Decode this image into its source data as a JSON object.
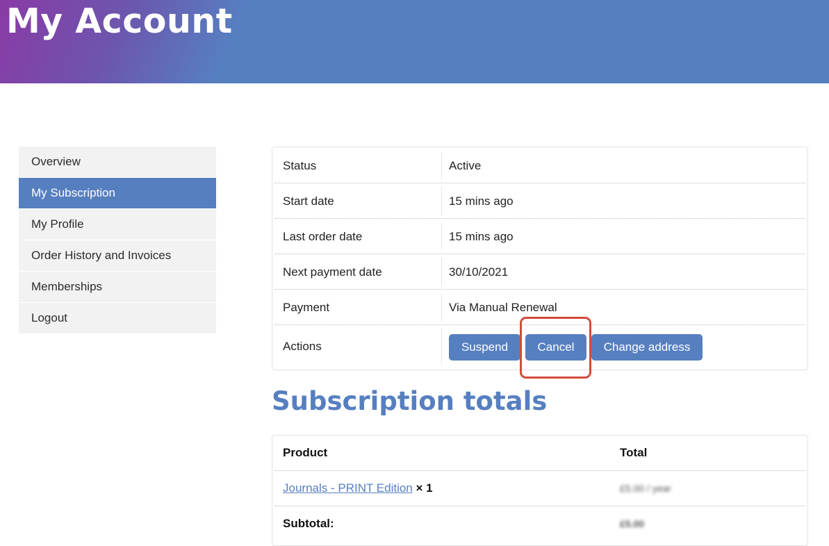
{
  "header": {
    "title": "My Account"
  },
  "sidebar": {
    "items": [
      {
        "label": "Overview"
      },
      {
        "label": "My Subscription"
      },
      {
        "label": "My Profile"
      },
      {
        "label": "Order History and Invoices"
      },
      {
        "label": "Memberships"
      },
      {
        "label": "Logout"
      }
    ],
    "active_index": 1
  },
  "subscription": {
    "rows": [
      {
        "label": "Status",
        "value": "Active"
      },
      {
        "label": "Start date",
        "value": "15 mins ago"
      },
      {
        "label": "Last order date",
        "value": "15 mins ago"
      },
      {
        "label": "Next payment date",
        "value": "30/10/2021"
      },
      {
        "label": "Payment",
        "value": "Via Manual Renewal"
      }
    ],
    "actions_label": "Actions",
    "actions": {
      "suspend": "Suspend",
      "cancel": "Cancel",
      "change_address": "Change address"
    }
  },
  "totals": {
    "heading": "Subscription totals",
    "col_product": "Product",
    "col_total": "Total",
    "product_link": "Journals - PRINT Edition",
    "product_qty": "× 1",
    "product_total": "£5.00 / year",
    "subtotal_label": "Subtotal:",
    "subtotal_value": "£5.00"
  },
  "colors": {
    "accent": "#567fc0",
    "gradient_start": "#8a3aa6",
    "highlight": "#d24b3a",
    "sidebar_bg": "#f2f2f2"
  }
}
